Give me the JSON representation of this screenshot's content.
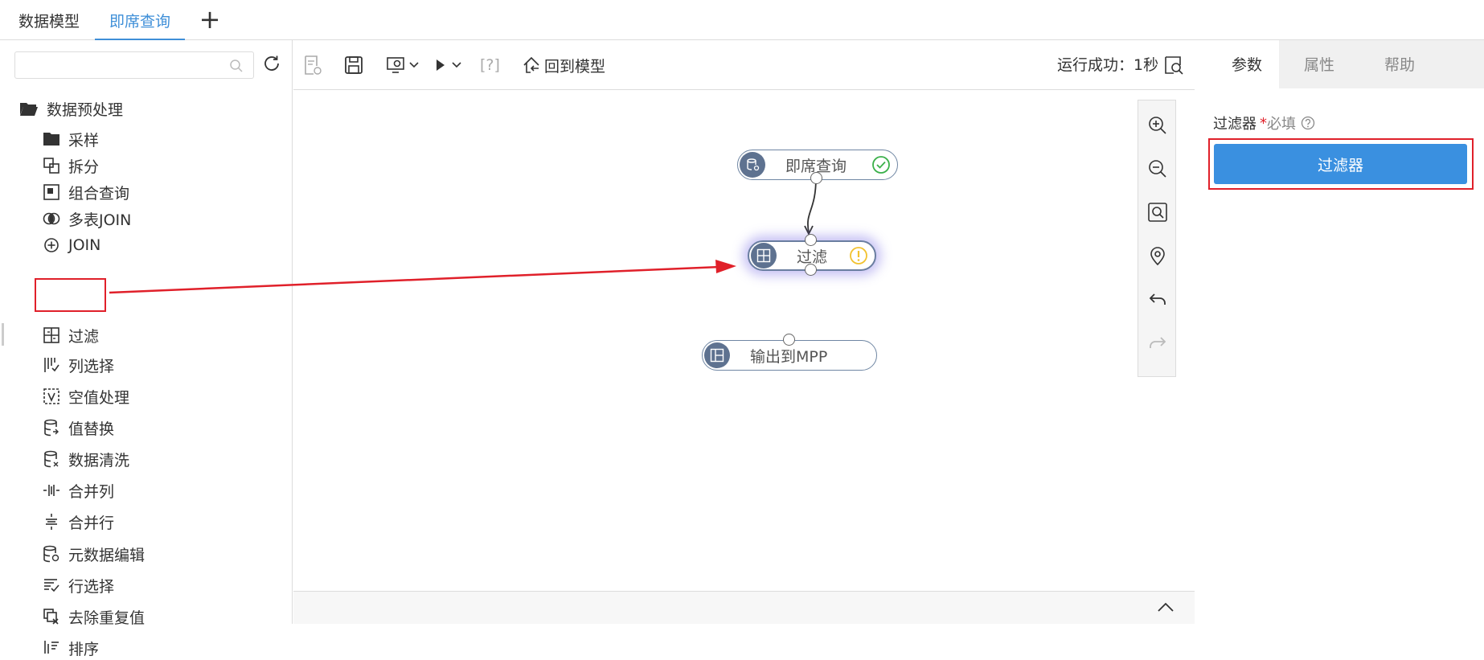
{
  "tabs": [
    {
      "label": "数据模型"
    },
    {
      "label": "即席查询"
    }
  ],
  "tab_add": "+",
  "sidebar": {
    "search_placeholder": "",
    "root_label": "数据预处理",
    "items": [
      {
        "label": "采样",
        "icon": "folder-icon"
      },
      {
        "label": "拆分",
        "icon": "split-icon"
      },
      {
        "label": "组合查询",
        "icon": "combine-icon"
      },
      {
        "label": "多表JOIN",
        "icon": "multi-join-icon"
      },
      {
        "label": "JOIN",
        "icon": "join-icon"
      },
      {
        "label": "过滤",
        "icon": "filter-icon"
      },
      {
        "label": "列选择",
        "icon": "column-select-icon"
      },
      {
        "label": "空值处理",
        "icon": "null-handle-icon"
      },
      {
        "label": "值替换",
        "icon": "value-replace-icon"
      },
      {
        "label": "数据清洗",
        "icon": "data-clean-icon"
      },
      {
        "label": "合并列",
        "icon": "merge-column-icon"
      },
      {
        "label": "合并行",
        "icon": "merge-row-icon"
      },
      {
        "label": "元数据编辑",
        "icon": "metadata-edit-icon"
      },
      {
        "label": "行选择",
        "icon": "row-select-icon"
      },
      {
        "label": "去除重复值",
        "icon": "dedupe-icon"
      },
      {
        "label": "排序",
        "icon": "sort-icon"
      }
    ]
  },
  "toolbar": {
    "help_label": "[?]",
    "back_label": "回到模型",
    "status": "运行成功：1秒"
  },
  "canvas": {
    "nodes": [
      {
        "label": "即席查询",
        "status": "success"
      },
      {
        "label": "过滤",
        "status": "warning"
      },
      {
        "label": "输出到MPP",
        "status": "none"
      }
    ]
  },
  "right_panel": {
    "tabs": [
      {
        "label": "参数"
      },
      {
        "label": "属性"
      },
      {
        "label": "帮助"
      }
    ],
    "field_label": "过滤器",
    "required_mark": "*",
    "required_text": "必填",
    "button_label": "过滤器"
  },
  "colors": {
    "accent": "#3a90e0",
    "highlight": "#e0202a",
    "node_border": "#6f86a3"
  }
}
